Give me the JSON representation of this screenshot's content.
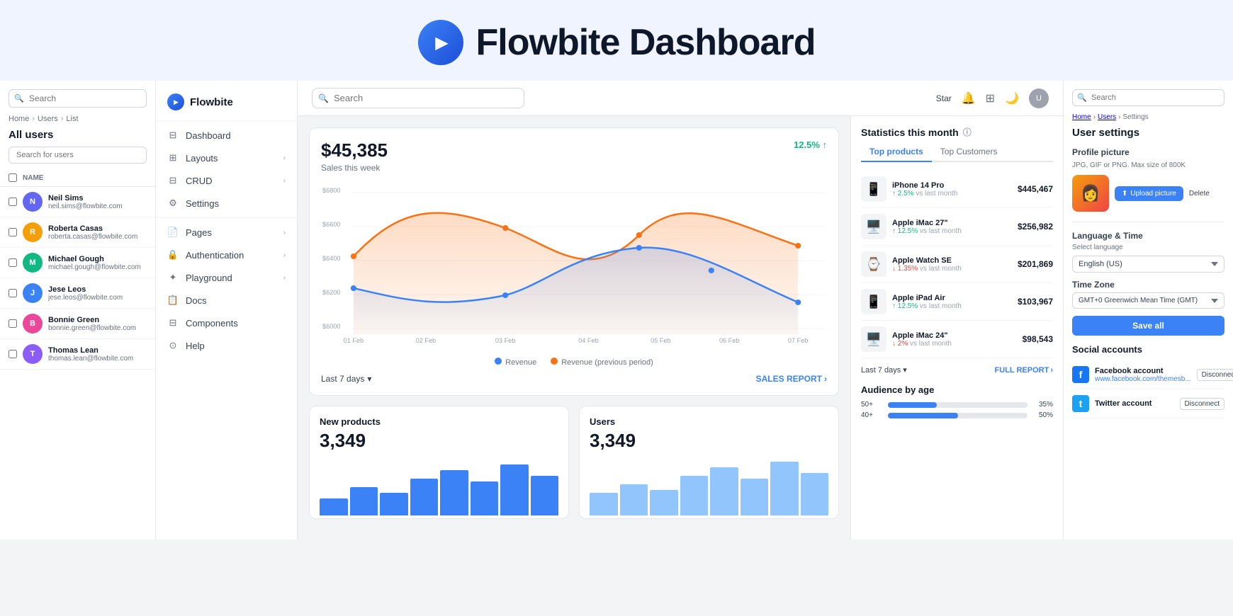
{
  "hero": {
    "title": "Flowbite Dashboard"
  },
  "topbar": {
    "search_placeholder": "Search",
    "star_label": "Star",
    "avatar_initials": "U"
  },
  "sidebar": {
    "brand": "Flowbite",
    "items": [
      {
        "id": "dashboard",
        "label": "Dashboard",
        "icon": "⊟",
        "hasChevron": false
      },
      {
        "id": "layouts",
        "label": "Layouts",
        "icon": "⊞",
        "hasChevron": true
      },
      {
        "id": "crud",
        "label": "CRUD",
        "icon": "⊟",
        "hasChevron": true
      },
      {
        "id": "settings",
        "label": "Settings",
        "icon": "⚙",
        "hasChevron": false
      },
      {
        "id": "pages",
        "label": "Pages",
        "icon": "📄",
        "hasChevron": true
      },
      {
        "id": "authentication",
        "label": "Authentication",
        "icon": "🔒",
        "hasChevron": true
      },
      {
        "id": "playground",
        "label": "Playground",
        "icon": "✦",
        "hasChevron": true
      },
      {
        "id": "docs",
        "label": "Docs",
        "icon": "📋",
        "hasChevron": false
      },
      {
        "id": "components",
        "label": "Components",
        "icon": "⊟",
        "hasChevron": false
      },
      {
        "id": "help",
        "label": "Help",
        "icon": "⊙",
        "hasChevron": false
      }
    ]
  },
  "left_panel": {
    "search_placeholder": "Search",
    "breadcrumb": [
      "Home",
      "Users",
      "List"
    ],
    "title": "All users",
    "user_search_placeholder": "Search for users",
    "column_name": "NAME",
    "users": [
      {
        "name": "Neil Sims",
        "email": "neil.sims@flowbite.com",
        "color": "#6366f1"
      },
      {
        "name": "Roberta Casas",
        "email": "roberta.casas@flowbite.com",
        "color": "#f59e0b"
      },
      {
        "name": "Michael Gough",
        "email": "michael.gough@flowbite.com",
        "color": "#10b981"
      },
      {
        "name": "Jese Leos",
        "email": "jese.leos@flowbite.com",
        "color": "#3b82f6"
      },
      {
        "name": "Bonnie Green",
        "email": "bonnie.green@flowbite.com",
        "color": "#ec4899"
      },
      {
        "name": "Thomas Lean",
        "email": "thomas.lean@flowbite.com",
        "color": "#8b5cf6"
      }
    ]
  },
  "chart": {
    "value": "$45,385",
    "label": "Sales this week",
    "badge": "12.5% ↑",
    "y_labels": [
      "$6800",
      "$6600",
      "$6400",
      "$6200",
      "$6000"
    ],
    "x_labels": [
      "01 Feb",
      "02 Feb",
      "03 Feb",
      "04 Feb",
      "05 Feb",
      "06 Feb",
      "07 Feb"
    ],
    "legend_revenue": "Revenue",
    "legend_prev": "Revenue (previous period)",
    "period": "Last 7 days",
    "report_link": "SALES REPORT"
  },
  "bottom_cards": [
    {
      "id": "new-products",
      "title": "New products",
      "value": "3,349"
    },
    {
      "id": "users",
      "title": "Users",
      "value": "3,349"
    }
  ],
  "stats": {
    "title": "Statistics this month",
    "tabs": [
      "Top products",
      "Top Customers"
    ],
    "active_tab": "Top products",
    "products": [
      {
        "name": "iPhone 14 Pro",
        "icon": "📱",
        "change": "↑ 2.5%",
        "change_type": "up",
        "vs": "vs last month",
        "price": "$445,467"
      },
      {
        "name": "Apple iMac 27\"",
        "icon": "🖥️",
        "change": "↑ 12.5%",
        "change_type": "up",
        "vs": "vs last month",
        "price": "$256,982"
      },
      {
        "name": "Apple Watch SE",
        "icon": "⌚",
        "change": "↓ 1.35%",
        "change_type": "down",
        "vs": "vs last month",
        "price": "$201,869"
      },
      {
        "name": "Apple iPad Air",
        "icon": "📱",
        "change": "↑ 12.5%",
        "change_type": "up",
        "vs": "vs last month",
        "price": "$103,967"
      },
      {
        "name": "Apple iMac 24\"",
        "icon": "🖥️",
        "change": "↓ 2%",
        "change_type": "down",
        "vs": "vs last month",
        "price": "$98,543"
      }
    ],
    "period": "Last 7 days",
    "report_link": "FULL REPORT"
  },
  "audience": {
    "title": "Audience by age",
    "bars": [
      {
        "label": "50+",
        "pct": 35
      },
      {
        "label": "40+",
        "pct": 50
      }
    ]
  },
  "far_right": {
    "search_placeholder": "Search",
    "breadcrumb": [
      "Home",
      "Users",
      "Settings"
    ],
    "title": "User settings",
    "profile_section": {
      "label": "Profile picture",
      "sub": "JPG, GIF or PNG. Max size of 800K",
      "upload_btn": "Upload picture",
      "delete_btn": "Delete"
    },
    "language": {
      "label": "Language & Time",
      "select_label": "Select language",
      "language_value": "English (US)",
      "tz_label": "Time Zone",
      "tz_value": "GMT+0 Greenwich Mean Time (GMT)"
    },
    "save_btn": "Save all",
    "social": {
      "title": "Social accounts",
      "items": [
        {
          "platform": "Facebook account",
          "url": "www.facebook.com/themesb...",
          "icon": "f",
          "color": "#1877f2",
          "disconnect": "Disconnect"
        },
        {
          "platform": "Twitter account",
          "url": "",
          "icon": "t",
          "color": "#1da1f2",
          "disconnect": "Disconnect"
        }
      ]
    }
  }
}
